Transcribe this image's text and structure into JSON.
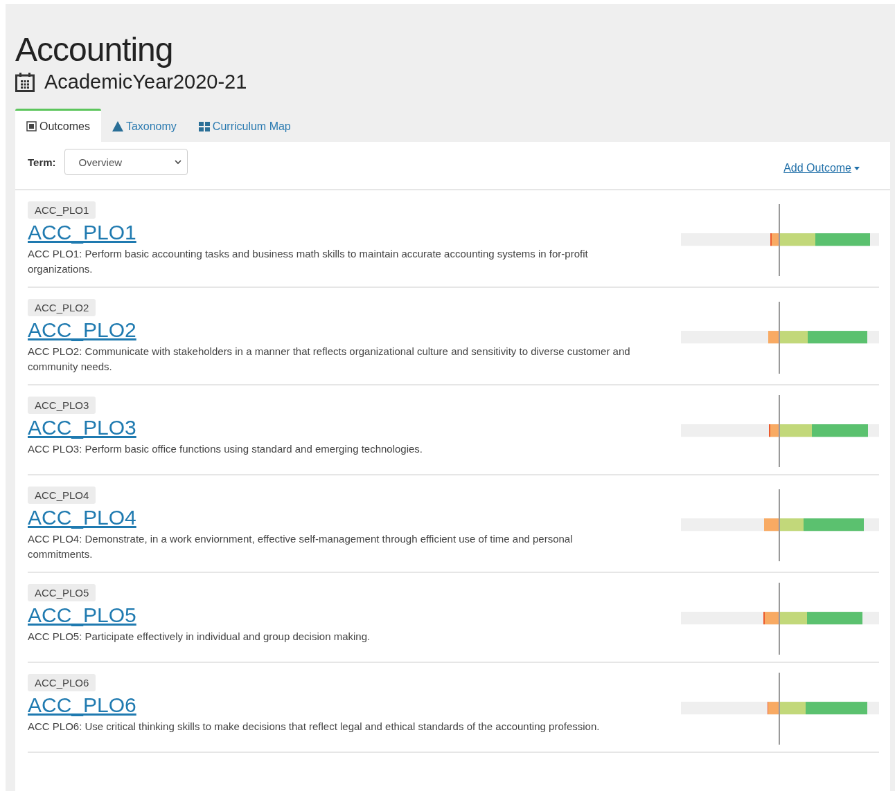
{
  "header": {
    "title": "Accounting",
    "year": "AcademicYear2020-21"
  },
  "tabs": [
    {
      "label": "Outcomes",
      "kind": "list",
      "selected": true
    },
    {
      "label": "Taxonomy",
      "kind": "triangle",
      "selected": false
    },
    {
      "label": "Curriculum Map",
      "kind": "grid",
      "selected": false
    }
  ],
  "toolbar": {
    "term_label": "Term:",
    "term_value": "Overview",
    "add_outcome": "Add Outcome"
  },
  "outcomes": [
    {
      "tag": "ACC_PLO1",
      "title": "ACC_PLO1",
      "description": "ACC PLO1: Perform basic accounting tasks and business math skills to maintain accurate accounting systems in for-profit organizations."
    },
    {
      "tag": "ACC_PLO2",
      "title": "ACC_PLO2",
      "description": "ACC PLO2: Communicate with stakeholders in a manner that reflects organizational culture and sensitivity to diverse customer and community needs."
    },
    {
      "tag": "ACC_PLO3",
      "title": "ACC_PLO3",
      "description": "ACC PLO3: Perform basic office functions using standard and emerging technologies."
    },
    {
      "tag": "ACC_PLO4",
      "title": "ACC_PLO4",
      "description": "ACC PLO4: Demonstrate, in a work enviornment, effective self-management through efficient use of time and personal commitments."
    },
    {
      "tag": "ACC_PLO5",
      "title": "ACC_PLO5",
      "description": "ACC PLO5: Participate effectively in individual and group decision making."
    },
    {
      "tag": "ACC_PLO6",
      "title": "ACC_PLO6",
      "description": "ACC PLO6: Use critical thinking skills to make decisions that reflect legal and ethical standards of the accounting profession."
    }
  ]
}
